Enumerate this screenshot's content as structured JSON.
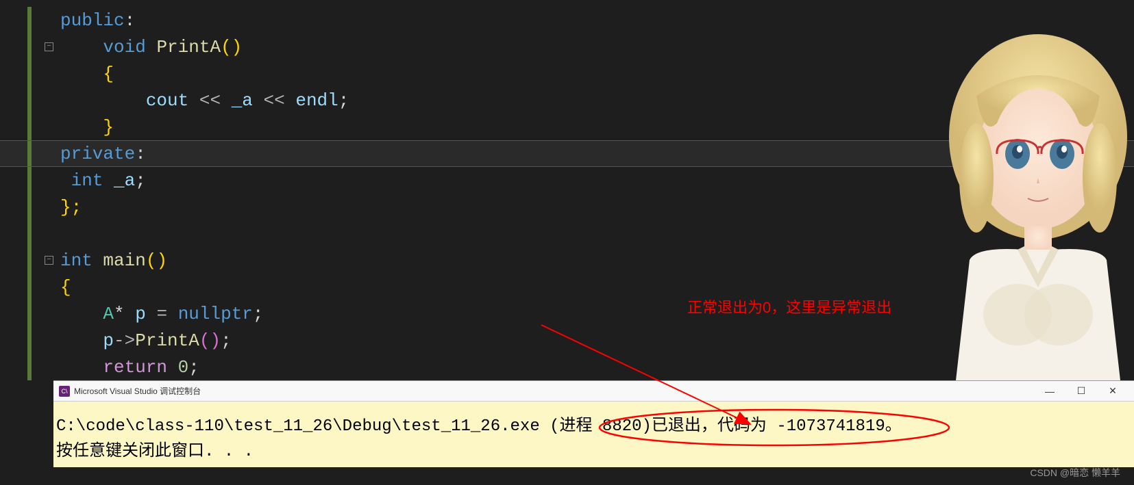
{
  "code": {
    "line1_kw": "public",
    "line2_void": "void",
    "line2_func": "PrintA",
    "line3_brace": "{",
    "line4_cout": "cout",
    "line4_a": "_a",
    "line4_endl": "endl",
    "line5_brace": "}",
    "line6_kw": "private",
    "line7_int": "int",
    "line7_a": "_a",
    "line8_brace": "};",
    "line10_int": "int",
    "line10_main": "main",
    "line11_brace": "{",
    "line12_type": "A",
    "line12_var": "p",
    "line12_null": "nullptr",
    "line13_p": "p",
    "line13_func": "PrintA",
    "line14_return": "return",
    "line14_zero": "0"
  },
  "console": {
    "title": "Microsoft Visual Studio 调试控制台",
    "line1": "C:\\code\\class-110\\test_11_26\\Debug\\test_11_26.exe (进程 8820)已退出，代码为 -1073741819。",
    "line2": "按任意键关闭此窗口. . ."
  },
  "annotation": {
    "text": "正常退出为0，这里是异常退出"
  },
  "watermark": "CSDN @暗恋 懒羊羊"
}
